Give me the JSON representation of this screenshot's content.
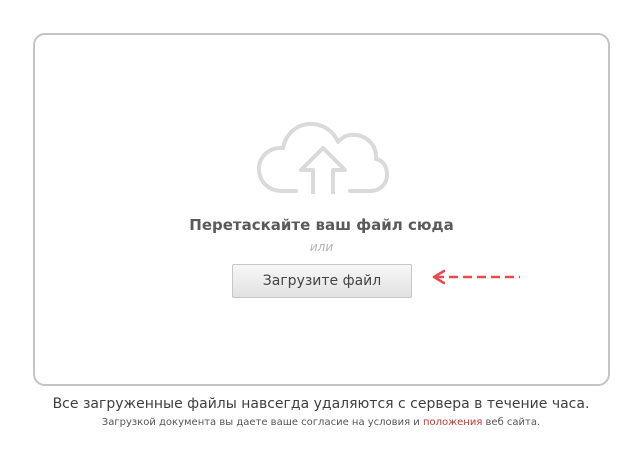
{
  "dropzone": {
    "icon": "cloud-upload-icon",
    "drag_text": "Перетаскайте ваш файл сюда",
    "or_text": "или",
    "upload_button_label": "Загрузите файл",
    "pointer_icon": "dashed-arrow-left-icon"
  },
  "footer": {
    "notice": "Все загруженные файлы навсегда удаляются с сервера в течение часа.",
    "terms_prefix": "Загрузкой документа вы даете ваше согласие на условия и",
    "terms_link": "положения",
    "terms_suffix": "веб сайта."
  },
  "colors": {
    "border": "#c4c4c4",
    "icon": "#dadada",
    "arrow": "#e84a4f",
    "link": "#c8322b"
  }
}
